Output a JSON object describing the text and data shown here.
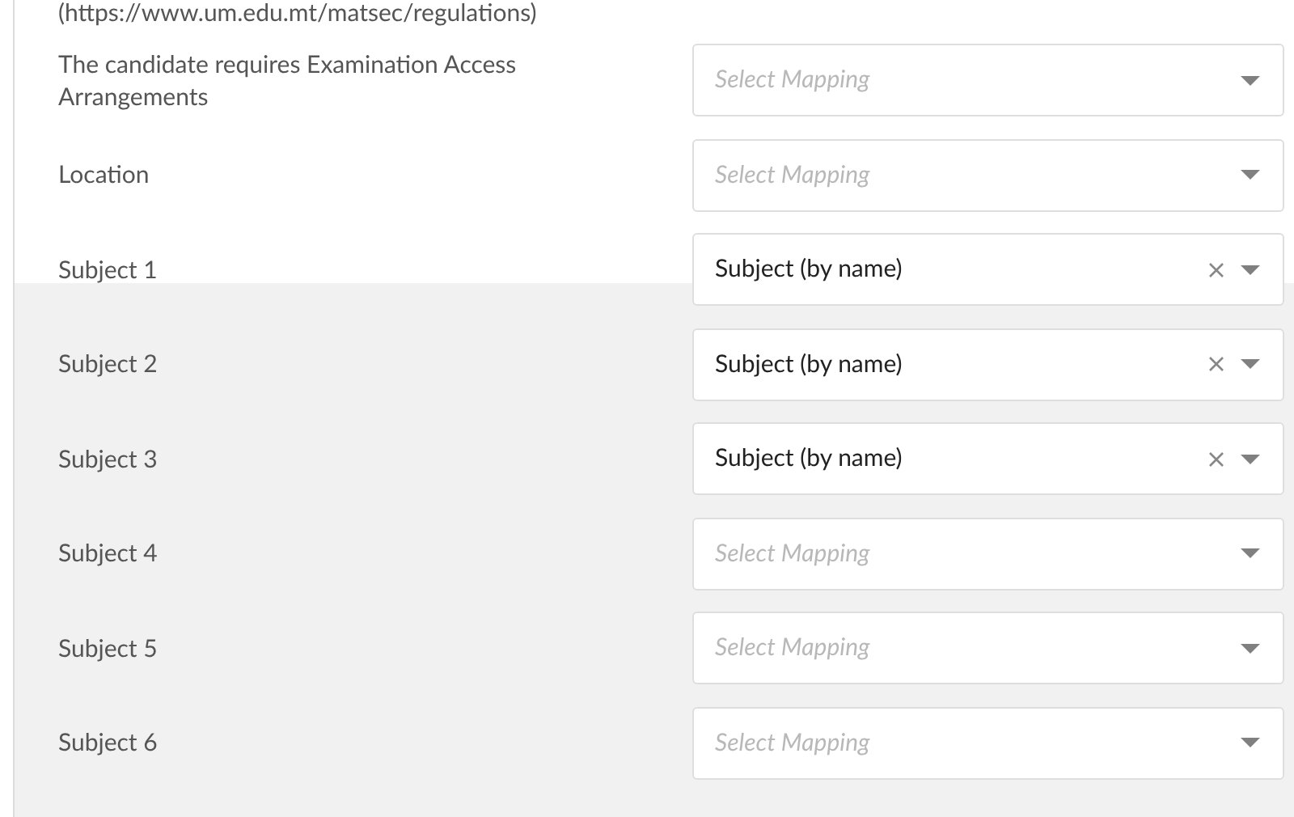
{
  "link_text": "(https://www.um.edu.mt/matsec/regulations)",
  "rows": [
    {
      "label": "The candidate requires Examination Access Arrangements",
      "placeholder": "Select Mapping"
    },
    {
      "label": "Location",
      "placeholder": "Select Mapping"
    },
    {
      "label": "Subject 1",
      "value": "Subject (by name)"
    },
    {
      "label": "Subject 2",
      "value": "Subject (by name)"
    },
    {
      "label": "Subject 3",
      "value": "Subject (by name)"
    },
    {
      "label": "Subject 4",
      "placeholder": "Select Mapping"
    },
    {
      "label": "Subject 5",
      "placeholder": "Select Mapping"
    },
    {
      "label": "Subject 6",
      "placeholder": "Select Mapping"
    }
  ]
}
